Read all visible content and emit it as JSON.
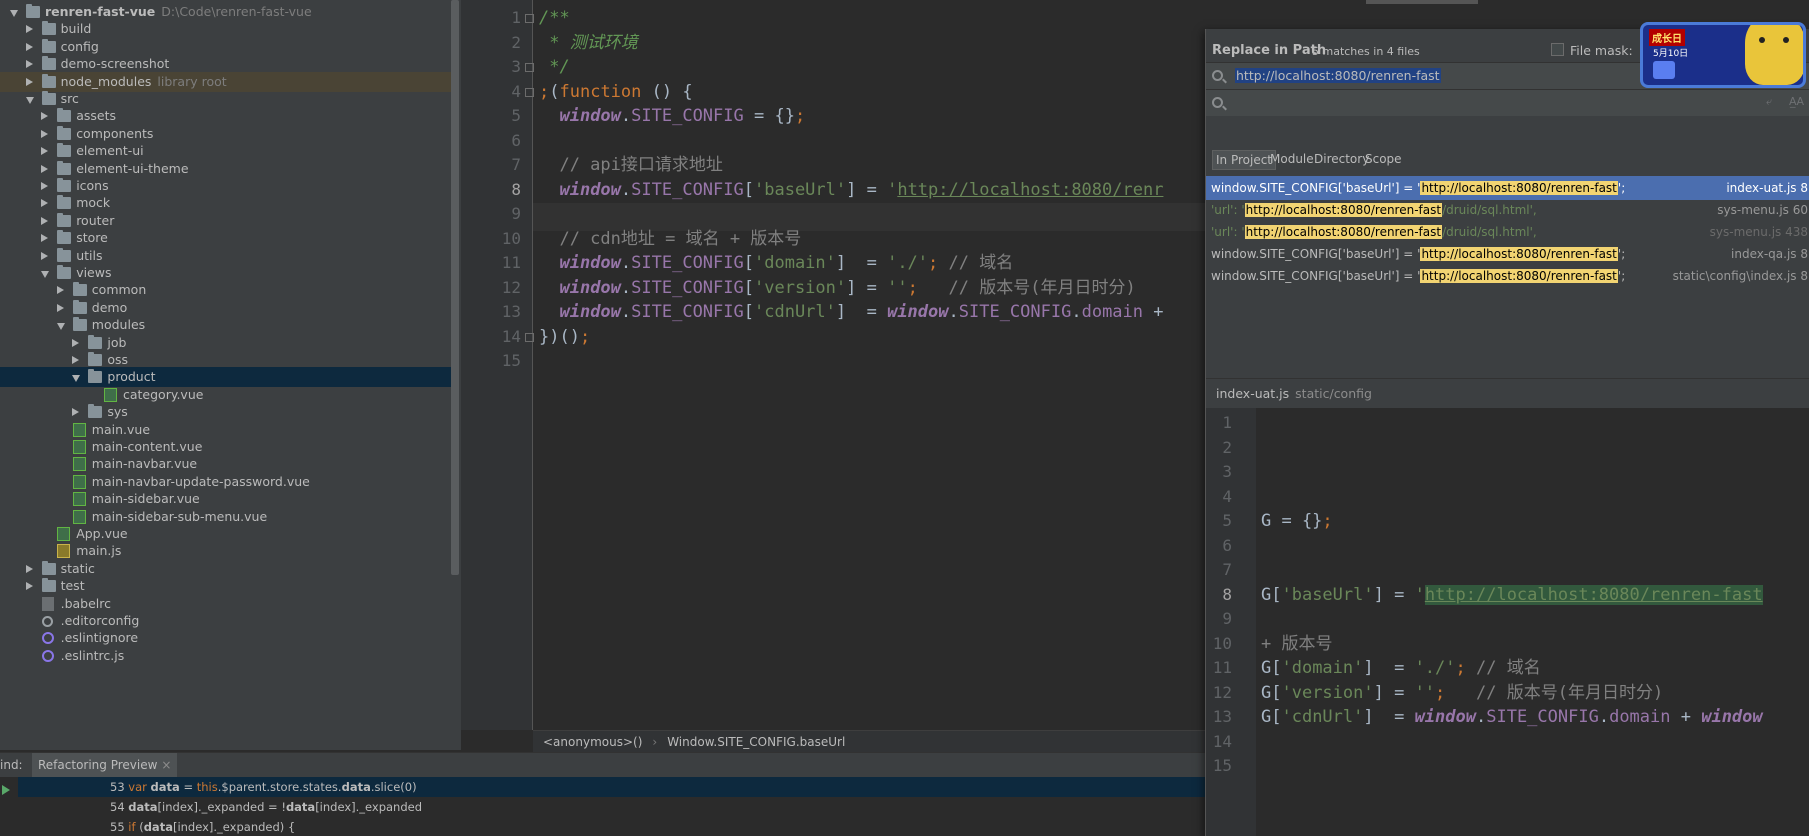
{
  "project": {
    "rows": [
      {
        "label": "renren-fast-vue",
        "sub": "D:\\Code\\renren-fast-vue",
        "depth": 0,
        "arrow": "open",
        "icon": "folder",
        "bold": true
      },
      {
        "label": "build",
        "depth": 1,
        "arrow": "closed",
        "icon": "folder"
      },
      {
        "label": "config",
        "depth": 1,
        "arrow": "closed",
        "icon": "folder"
      },
      {
        "label": "demo-screenshot",
        "depth": 1,
        "arrow": "closed",
        "icon": "folder"
      },
      {
        "label": "node_modules",
        "sub": "library root",
        "depth": 1,
        "arrow": "closed",
        "icon": "folder",
        "excluded": true
      },
      {
        "label": "src",
        "depth": 1,
        "arrow": "open",
        "icon": "folder"
      },
      {
        "label": "assets",
        "depth": 2,
        "arrow": "closed",
        "icon": "folder"
      },
      {
        "label": "components",
        "depth": 2,
        "arrow": "closed",
        "icon": "folder"
      },
      {
        "label": "element-ui",
        "depth": 2,
        "arrow": "closed",
        "icon": "folder"
      },
      {
        "label": "element-ui-theme",
        "depth": 2,
        "arrow": "closed",
        "icon": "folder"
      },
      {
        "label": "icons",
        "depth": 2,
        "arrow": "closed",
        "icon": "folder"
      },
      {
        "label": "mock",
        "depth": 2,
        "arrow": "closed",
        "icon": "folder"
      },
      {
        "label": "router",
        "depth": 2,
        "arrow": "closed",
        "icon": "folder"
      },
      {
        "label": "store",
        "depth": 2,
        "arrow": "closed",
        "icon": "folder"
      },
      {
        "label": "utils",
        "depth": 2,
        "arrow": "closed",
        "icon": "folder"
      },
      {
        "label": "views",
        "depth": 2,
        "arrow": "open",
        "icon": "folder"
      },
      {
        "label": "common",
        "depth": 3,
        "arrow": "closed",
        "icon": "folder"
      },
      {
        "label": "demo",
        "depth": 3,
        "arrow": "closed",
        "icon": "folder"
      },
      {
        "label": "modules",
        "depth": 3,
        "arrow": "open",
        "icon": "folder"
      },
      {
        "label": "job",
        "depth": 4,
        "arrow": "closed",
        "icon": "folder"
      },
      {
        "label": "oss",
        "depth": 4,
        "arrow": "closed",
        "icon": "folder"
      },
      {
        "label": "product",
        "depth": 4,
        "arrow": "open",
        "icon": "folder",
        "selected": true
      },
      {
        "label": "category.vue",
        "depth": 5,
        "arrow": "none",
        "icon": "vue"
      },
      {
        "label": "sys",
        "depth": 4,
        "arrow": "closed",
        "icon": "folder"
      },
      {
        "label": "main.vue",
        "depth": 3,
        "arrow": "none",
        "icon": "vue"
      },
      {
        "label": "main-content.vue",
        "depth": 3,
        "arrow": "none",
        "icon": "vue"
      },
      {
        "label": "main-navbar.vue",
        "depth": 3,
        "arrow": "none",
        "icon": "vue"
      },
      {
        "label": "main-navbar-update-password.vue",
        "depth": 3,
        "arrow": "none",
        "icon": "vue"
      },
      {
        "label": "main-sidebar.vue",
        "depth": 3,
        "arrow": "none",
        "icon": "vue"
      },
      {
        "label": "main-sidebar-sub-menu.vue",
        "depth": 3,
        "arrow": "none",
        "icon": "vue"
      },
      {
        "label": "App.vue",
        "depth": 2,
        "arrow": "none",
        "icon": "vue"
      },
      {
        "label": "main.js",
        "depth": 2,
        "arrow": "none",
        "icon": "js"
      },
      {
        "label": "static",
        "depth": 1,
        "arrow": "closed",
        "icon": "folder"
      },
      {
        "label": "test",
        "depth": 1,
        "arrow": "closed",
        "icon": "folder"
      },
      {
        "label": ".babelrc",
        "depth": 1,
        "arrow": "none",
        "icon": "babel"
      },
      {
        "label": ".editorconfig",
        "depth": 1,
        "arrow": "none",
        "icon": "cfg"
      },
      {
        "label": ".eslintignore",
        "depth": 1,
        "arrow": "none",
        "icon": "lint"
      },
      {
        "label": ".eslintrc.js",
        "depth": 1,
        "arrow": "none",
        "icon": "lint"
      }
    ]
  },
  "editor": {
    "line_numbers": [
      "1",
      "2",
      "3",
      "4",
      "5",
      "6",
      "7",
      "8",
      "9",
      "10",
      "11",
      "12",
      "13",
      "14",
      "15"
    ],
    "current_line": "8",
    "lines": [
      [
        {
          "t": "/**",
          "c": "c-doc"
        }
      ],
      [
        {
          "t": " * 测试环境",
          "c": "c-doc"
        }
      ],
      [
        {
          "t": " */",
          "c": "c-doc"
        }
      ],
      [
        {
          "t": ";",
          "c": "c-kw"
        },
        {
          "t": "(",
          "c": "c-def"
        },
        {
          "t": "function",
          "c": "c-kw"
        },
        {
          "t": " () {",
          "c": "c-def"
        }
      ],
      [
        {
          "t": "  ",
          "c": "c-def"
        },
        {
          "t": "window",
          "c": "c-win"
        },
        {
          "t": ".",
          "c": "c-def"
        },
        {
          "t": "SITE_CONFIG",
          "c": "c-prop"
        },
        {
          "t": " = {}",
          "c": "c-def"
        },
        {
          "t": ";",
          "c": "c-kw"
        }
      ],
      [],
      [
        {
          "t": "  // api接口请求地址",
          "c": "c-com"
        }
      ],
      [
        {
          "t": "  ",
          "c": "c-def"
        },
        {
          "t": "window",
          "c": "c-win"
        },
        {
          "t": ".",
          "c": "c-def"
        },
        {
          "t": "SITE_CONFIG",
          "c": "c-prop"
        },
        {
          "t": "[",
          "c": "c-def"
        },
        {
          "t": "'baseUrl'",
          "c": "c-str"
        },
        {
          "t": "] = ",
          "c": "c-def"
        },
        {
          "t": "'",
          "c": "c-str"
        },
        {
          "t": "http://localhost:8080/renr",
          "c": "c-url2"
        }
      ],
      [],
      [
        {
          "t": "  // cdn地址 = 域名 + 版本号",
          "c": "c-com"
        }
      ],
      [
        {
          "t": "  ",
          "c": "c-def"
        },
        {
          "t": "window",
          "c": "c-win"
        },
        {
          "t": ".",
          "c": "c-def"
        },
        {
          "t": "SITE_CONFIG",
          "c": "c-prop"
        },
        {
          "t": "[",
          "c": "c-def"
        },
        {
          "t": "'domain'",
          "c": "c-str"
        },
        {
          "t": "]  = ",
          "c": "c-def"
        },
        {
          "t": "'./'",
          "c": "c-str"
        },
        {
          "t": ";",
          "c": "c-kw"
        },
        {
          "t": " // 域名",
          "c": "c-com"
        }
      ],
      [
        {
          "t": "  ",
          "c": "c-def"
        },
        {
          "t": "window",
          "c": "c-win"
        },
        {
          "t": ".",
          "c": "c-def"
        },
        {
          "t": "SITE_CONFIG",
          "c": "c-prop"
        },
        {
          "t": "[",
          "c": "c-def"
        },
        {
          "t": "'version'",
          "c": "c-str"
        },
        {
          "t": "] = ",
          "c": "c-def"
        },
        {
          "t": "''",
          "c": "c-str"
        },
        {
          "t": ";",
          "c": "c-kw"
        },
        {
          "t": "   // 版本号(年月日时分)",
          "c": "c-com"
        }
      ],
      [
        {
          "t": "  ",
          "c": "c-def"
        },
        {
          "t": "window",
          "c": "c-win"
        },
        {
          "t": ".",
          "c": "c-def"
        },
        {
          "t": "SITE_CONFIG",
          "c": "c-prop"
        },
        {
          "t": "[",
          "c": "c-def"
        },
        {
          "t": "'cdnUrl'",
          "c": "c-str"
        },
        {
          "t": "]  = ",
          "c": "c-def"
        },
        {
          "t": "window",
          "c": "c-win"
        },
        {
          "t": ".",
          "c": "c-def"
        },
        {
          "t": "SITE_CONFIG",
          "c": "c-prop"
        },
        {
          "t": ".",
          "c": "c-def"
        },
        {
          "t": "domain",
          "c": "c-prop"
        },
        {
          "t": " +",
          "c": "c-def"
        }
      ],
      [
        {
          "t": "})()",
          "c": "c-def"
        },
        {
          "t": ";",
          "c": "c-kw"
        }
      ],
      []
    ],
    "breadcrumb": [
      "<anonymous>()",
      "Window.SITE_CONFIG.baseUrl"
    ]
  },
  "replace_popup": {
    "title": "Replace in Path",
    "count": "5 matches in 4 files",
    "file_mask_label": "File mask:",
    "search_text": "http://localhost:8080/renren-fast",
    "replace_text": "",
    "field_buttons": [
      "⤶",
      "A̲A"
    ],
    "scopes": [
      "In Project",
      "Module",
      "Directory",
      "Scope"
    ],
    "active_scope": "In Project",
    "results": [
      {
        "pre": "window.SITE_CONFIG['baseUrl'] = '",
        "match": "http://localhost:8080/renren-fast",
        "post": "';",
        "file": "index-uat.js 8",
        "selected": true,
        "dim": false,
        "str": false
      },
      {
        "pre": "'url': '",
        "match": "http://localhost:8080/renren-fast",
        "post": "/druid/sql.html',",
        "file": "sys-menu.js 60",
        "selected": false,
        "dim": false,
        "str": true
      },
      {
        "pre": "'url': '",
        "match": "http://localhost:8080/renren-fast",
        "post": "/druid/sql.html',",
        "file": "sys-menu.js 438",
        "selected": false,
        "dim": true,
        "str": true
      },
      {
        "pre": "window.SITE_CONFIG['baseUrl'] = '",
        "match": "http://localhost:8080/renren-fast",
        "post": "';",
        "file": "index-qa.js 8",
        "selected": false,
        "dim": false,
        "str": false
      },
      {
        "pre": "window.SITE_CONFIG['baseUrl'] = '",
        "match": "http://localhost:8080/renren-fast",
        "post": "';",
        "file": "static\\config\\index.js 8",
        "selected": false,
        "dim": false,
        "str": false
      }
    ],
    "preview_file": "index-uat.js",
    "preview_path": "static/config",
    "preview_line_numbers": [
      "1",
      "2",
      "3",
      "4",
      "5",
      "6",
      "7",
      "8",
      "9",
      "10",
      "11",
      "12",
      "13",
      "14",
      "15"
    ],
    "preview_current_line": "8",
    "preview_lines": [
      [],
      [],
      [],
      [],
      [
        {
          "t": "G = {}",
          "c": "c-def"
        },
        {
          "t": ";",
          "c": "c-kw"
        }
      ],
      [],
      [],
      [
        {
          "t": "G[",
          "c": "c-def"
        },
        {
          "t": "'baseUrl'",
          "c": "c-str"
        },
        {
          "t": "] = ",
          "c": "c-def"
        },
        {
          "t": "'",
          "c": "c-str"
        },
        {
          "t": "http://localhost:8080/renren-fast",
          "c": "c-url2 pv-match"
        }
      ],
      [],
      [
        {
          "t": "+ 版本号",
          "c": "c-com"
        }
      ],
      [
        {
          "t": "G[",
          "c": "c-def"
        },
        {
          "t": "'domain'",
          "c": "c-str"
        },
        {
          "t": "]  = ",
          "c": "c-def"
        },
        {
          "t": "'./'",
          "c": "c-str"
        },
        {
          "t": ";",
          "c": "c-kw"
        },
        {
          "t": " // 域名",
          "c": "c-com"
        }
      ],
      [
        {
          "t": "G[",
          "c": "c-def"
        },
        {
          "t": "'version'",
          "c": "c-str"
        },
        {
          "t": "] = ",
          "c": "c-def"
        },
        {
          "t": "''",
          "c": "c-str"
        },
        {
          "t": ";",
          "c": "c-kw"
        },
        {
          "t": "   // 版本号(年月日时分)",
          "c": "c-com"
        }
      ],
      [
        {
          "t": "G[",
          "c": "c-def"
        },
        {
          "t": "'cdnUrl'",
          "c": "c-str"
        },
        {
          "t": "]  = ",
          "c": "c-def"
        },
        {
          "t": "window",
          "c": "c-win"
        },
        {
          "t": ".",
          "c": "c-def"
        },
        {
          "t": "SITE_CONFIG",
          "c": "c-prop"
        },
        {
          "t": ".",
          "c": "c-def"
        },
        {
          "t": "domain",
          "c": "c-prop"
        },
        {
          "t": " + ",
          "c": "c-def"
        },
        {
          "t": "window",
          "c": "c-win"
        }
      ],
      [],
      []
    ]
  },
  "mascot": {
    "badge": "成长日",
    "date": "5月10日"
  },
  "bottom": {
    "find_label": "ind:",
    "tab_label": "Refactoring Preview",
    "close_glyph": "×",
    "usage_lines": [
      {
        "num": "53",
        "parts": [
          {
            "t": "var ",
            "c": "u-kw"
          },
          {
            "t": "data",
            "c": "u-b"
          },
          {
            "t": " = ",
            "c": ""
          },
          {
            "t": "this",
            "c": "u-kw"
          },
          {
            "t": ".$parent.store.states.",
            "c": ""
          },
          {
            "t": "data",
            "c": "u-b"
          },
          {
            "t": ".slice(0)",
            "c": ""
          }
        ],
        "selected": true
      },
      {
        "num": "54",
        "parts": [
          {
            "t": "data",
            "c": "u-b"
          },
          {
            "t": "[index]._expanded = !",
            "c": ""
          },
          {
            "t": "data",
            "c": "u-b"
          },
          {
            "t": "[index]._expanded",
            "c": ""
          }
        ],
        "selected": false
      },
      {
        "num": "55",
        "parts": [
          {
            "t": "if ",
            "c": "u-kw"
          },
          {
            "t": "(",
            "c": ""
          },
          {
            "t": "data",
            "c": "u-b"
          },
          {
            "t": "[index]._expanded) {",
            "c": ""
          }
        ],
        "selected": false
      }
    ]
  }
}
